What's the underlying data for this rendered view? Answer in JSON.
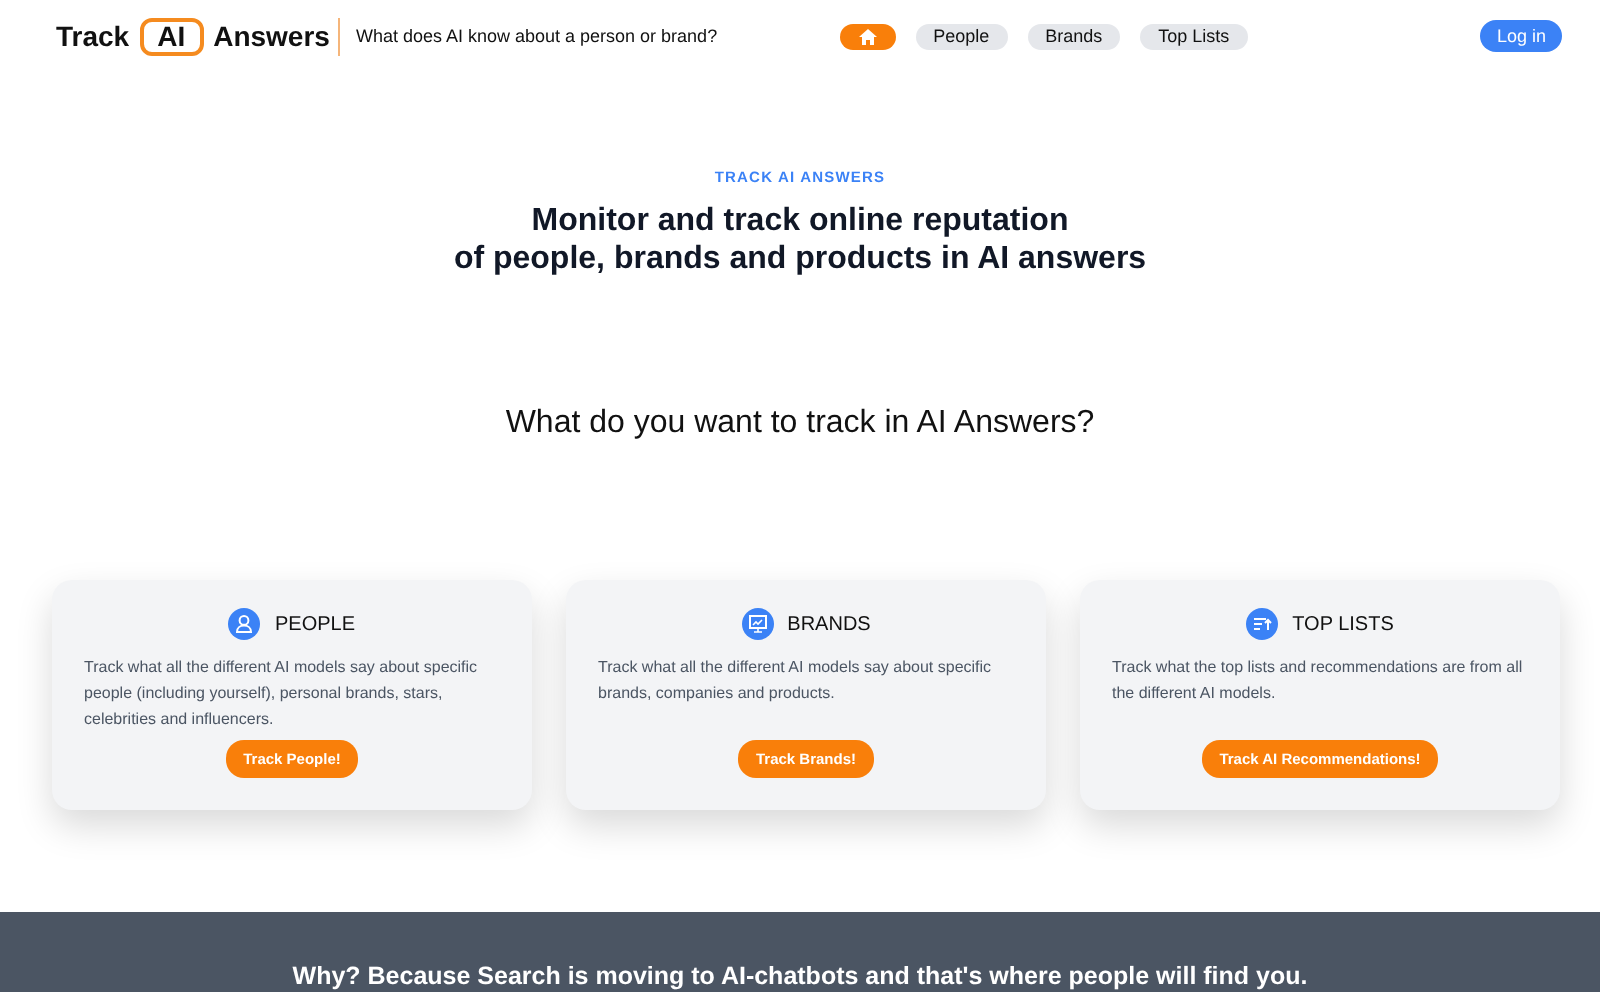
{
  "logo": {
    "before": "Track",
    "boxed": "AI",
    "after": "Answers"
  },
  "tagline": "What does AI know about a person or brand?",
  "nav": [
    {
      "kind": "home",
      "selected": true
    },
    {
      "kind": "text",
      "label": "People",
      "selected": false
    },
    {
      "kind": "text",
      "label": "Brands",
      "selected": false
    },
    {
      "kind": "text",
      "label": "Top Lists",
      "selected": false
    }
  ],
  "login": "Log in",
  "hero": {
    "eyebrow": "TRACK AI ANSWERS",
    "title_lines": [
      "Monitor and track online reputation",
      "of people, brands and products in AI answers"
    ]
  },
  "question": "What do you want to track in AI Answers?",
  "cards": [
    {
      "kind": "person",
      "title": "PEOPLE",
      "text": "Track what all the different AI models say about specific people (including yourself), personal brands, stars, celebrities and influencers.",
      "button": "Track People!"
    },
    {
      "kind": "monitor",
      "title": "BRANDS",
      "text": "Track what all the different AI models say about specific brands, companies and products.",
      "button": "Track Brands!"
    },
    {
      "kind": "list",
      "title": "TOP LISTS",
      "text": "Track what the top lists and recommendations are from all the different AI models.",
      "button": "Track AI Recommendations!"
    }
  ],
  "footer": "Why? Because Search is moving to AI-chatbots and that's where people will find you."
}
